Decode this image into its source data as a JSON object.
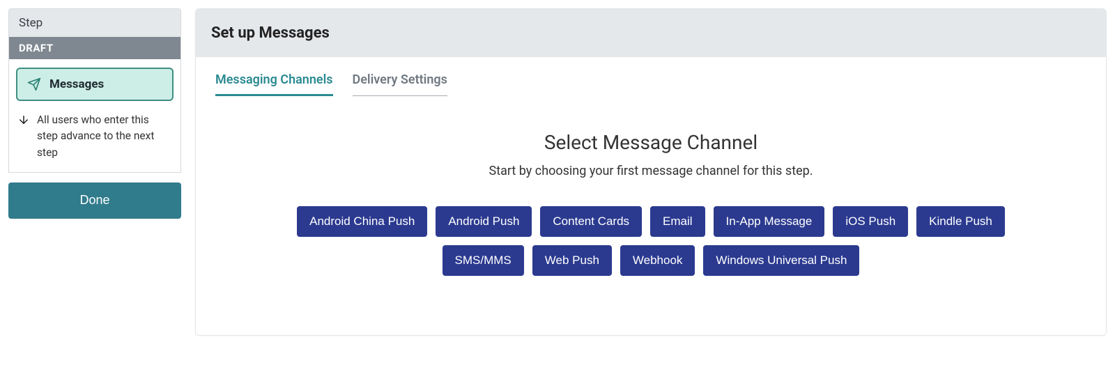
{
  "sidebar": {
    "step_label": "Step",
    "draft_label": "DRAFT",
    "step_name": "Messages",
    "advance_text": "All users who enter this step advance to the next step",
    "done_label": "Done"
  },
  "main": {
    "title": "Set up Messages",
    "tabs": {
      "messaging_channels": "Messaging Channels",
      "delivery_settings": "Delivery Settings"
    },
    "select_heading": "Select Message Channel",
    "select_subtext": "Start by choosing your first message channel for this step.",
    "channels": [
      "Android China Push",
      "Android Push",
      "Content Cards",
      "Email",
      "In-App Message",
      "iOS Push",
      "Kindle Push",
      "SMS/MMS",
      "Web Push",
      "Webhook",
      "Windows Universal Push"
    ]
  }
}
